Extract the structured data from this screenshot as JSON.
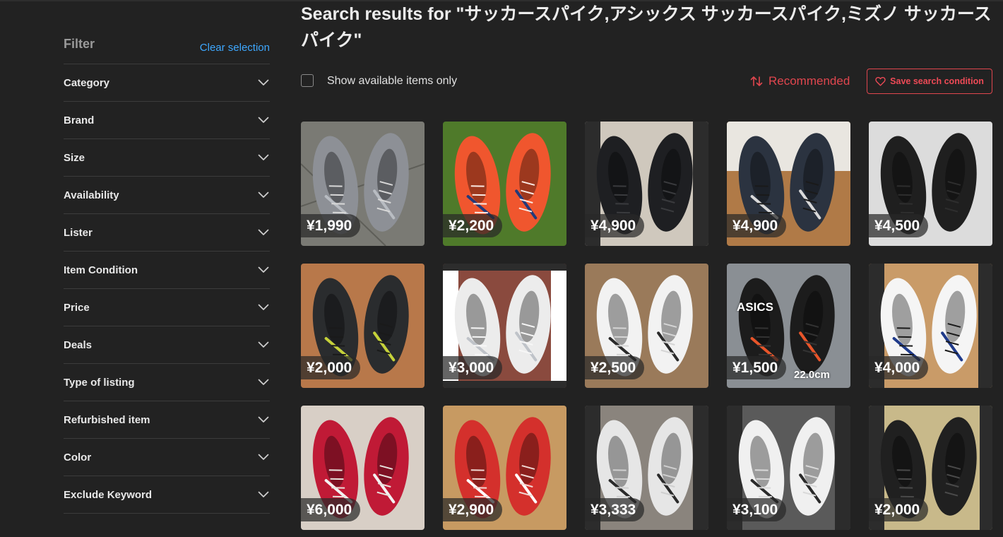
{
  "sidebar": {
    "title": "Filter",
    "clear_label": "Clear selection",
    "items": [
      {
        "label": "Category"
      },
      {
        "label": "Brand"
      },
      {
        "label": "Size"
      },
      {
        "label": "Availability"
      },
      {
        "label": "Lister"
      },
      {
        "label": "Item Condition"
      },
      {
        "label": "Price"
      },
      {
        "label": "Deals"
      },
      {
        "label": "Type of listing"
      },
      {
        "label": "Refurbished item"
      },
      {
        "label": "Color"
      },
      {
        "label": "Exclude Keyword"
      }
    ]
  },
  "main": {
    "title": "Search results for \"サッカースパイク,アシックス サッカースパイク,ミズノ サッカースパイク\"",
    "available_label": "Show available items only",
    "sort_label": "Recommended",
    "save_label": "Save search condition"
  },
  "colors": {
    "accent": "#e0464e",
    "link": "#3ea8ff",
    "background": "#222222"
  },
  "items": [
    {
      "price": "¥1,990",
      "image": "grey-shoes-on-tile"
    },
    {
      "price": "¥2,200",
      "image": "orange-shoes-on-grass"
    },
    {
      "price": "¥4,900",
      "image": "black-shoes-on-floor"
    },
    {
      "price": "¥4,900",
      "image": "black-blue-cleats-on-wood"
    },
    {
      "price": "¥4,500",
      "image": "black-cleats-on-white"
    },
    {
      "price": "¥2,000",
      "image": "black-cleats-on-wood"
    },
    {
      "price": "¥3,000",
      "image": "white-shoes-on-red-carpet"
    },
    {
      "price": "¥2,500",
      "image": "white-cleats-on-wood"
    },
    {
      "price": "¥1,500",
      "image": "asics-black-red-cleats",
      "overlay_brand": "ASICS",
      "overlay_size": "22.0cm"
    },
    {
      "price": "¥4,000",
      "image": "white-shoes-on-box"
    },
    {
      "price": "¥6,000",
      "image": "red-cleat-held"
    },
    {
      "price": "¥2,900",
      "image": "red-shoes-on-wood"
    },
    {
      "price": "¥3,333",
      "image": "white-shoes-on-floor"
    },
    {
      "price": "¥3,100",
      "image": "white-shoes-on-asphalt"
    },
    {
      "price": "¥2,000",
      "image": "black-shoes-on-tatami"
    }
  ]
}
